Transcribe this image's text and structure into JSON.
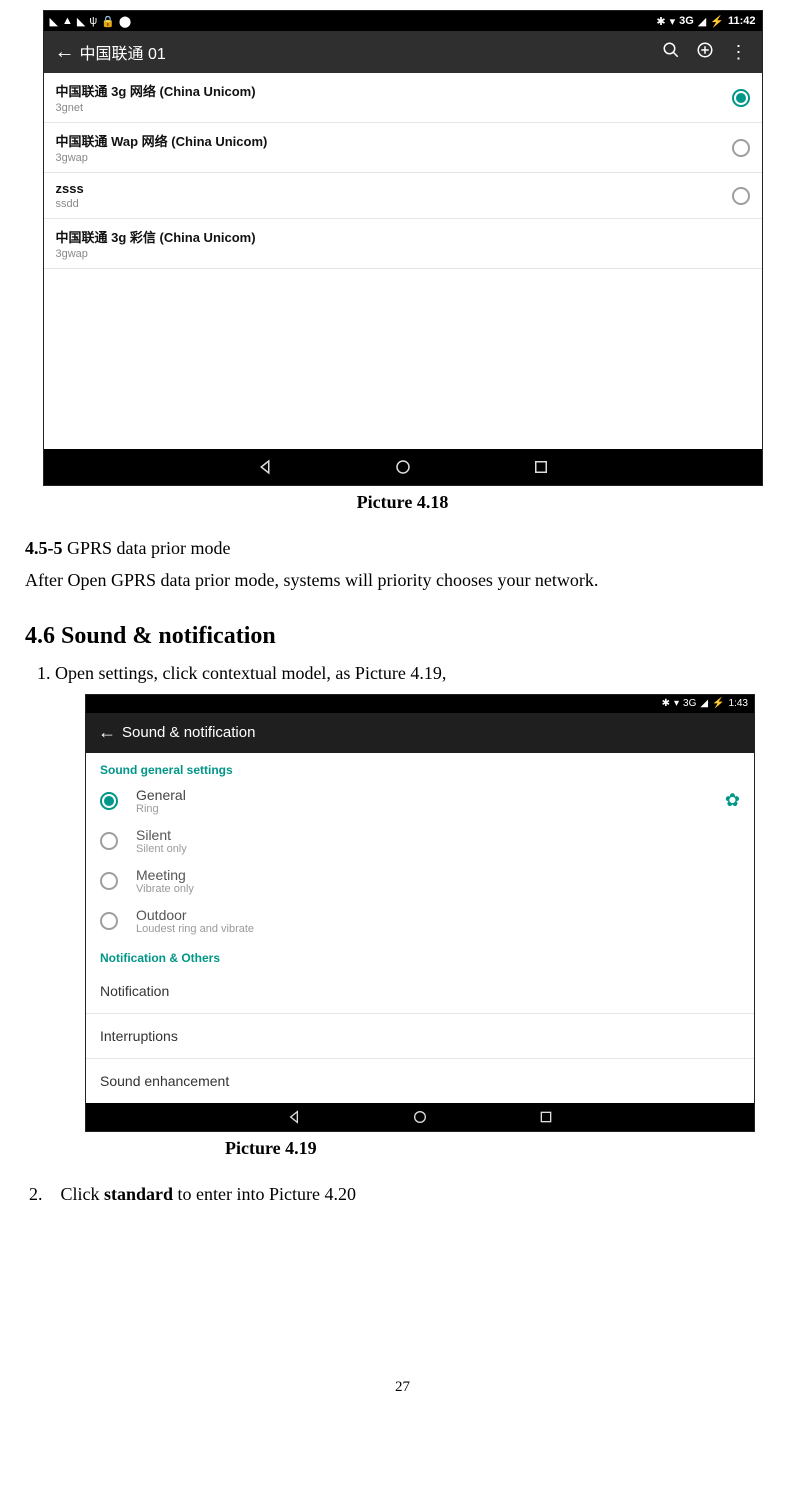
{
  "screenshot1": {
    "status": {
      "left_icons": [
        "◣",
        "▲",
        "◣",
        "ψ",
        "🔒",
        "⬤"
      ],
      "right_icons": [
        "✱",
        "▾",
        "3G",
        "◢",
        "⚡"
      ],
      "time": "11:42"
    },
    "app_bar": {
      "title": "中国联通 01",
      "search_icon": "search-icon",
      "add_icon": "add-icon",
      "more_icon": "more-icon"
    },
    "apns": [
      {
        "title": "中国联通 3g 网络 (China Unicom)",
        "sub": "3gnet",
        "selected": true
      },
      {
        "title": "中国联通 Wap 网络 (China Unicom)",
        "sub": "3gwap",
        "selected": false
      },
      {
        "title": "zsss",
        "sub": "ssdd",
        "selected": false
      },
      {
        "title": "中国联通 3g 彩信 (China Unicom)",
        "sub": "3gwap",
        "selected": null
      }
    ]
  },
  "text": {
    "caption418": "Picture 4.18",
    "sec455_label": "4.5-5",
    "sec455_title": " GPRS data prior mode",
    "sec455_body": "After Open GPRS data prior mode, systems will priority chooses your network.",
    "h46": "4.6 Sound & notification",
    "step1": "1. Open settings, click contextual model, as Picture 4.19,",
    "caption419": "Picture 4.19",
    "step2_num": "2.",
    "step2_a": "Click ",
    "step2_b": "standard",
    "step2_c": " to enter into Picture 4.20",
    "page_num": "27"
  },
  "screenshot2": {
    "status": {
      "right_icons": [
        "✱",
        "▾",
        "3G",
        "◢",
        "⚡"
      ],
      "time": "1:43"
    },
    "app_bar": {
      "title": "Sound & notification"
    },
    "section1": "Sound general settings",
    "profiles": [
      {
        "title": "General",
        "sub": "Ring",
        "selected": true,
        "gear": true
      },
      {
        "title": "Silent",
        "sub": "Silent only",
        "selected": false,
        "gear": false
      },
      {
        "title": "Meeting",
        "sub": "Vibrate only",
        "selected": false,
        "gear": false
      },
      {
        "title": "Outdoor",
        "sub": "Loudest ring and vibrate",
        "selected": false,
        "gear": false
      }
    ],
    "section2": "Notification & Others",
    "rows": [
      "Notification",
      "Interruptions",
      "Sound enhancement"
    ]
  }
}
